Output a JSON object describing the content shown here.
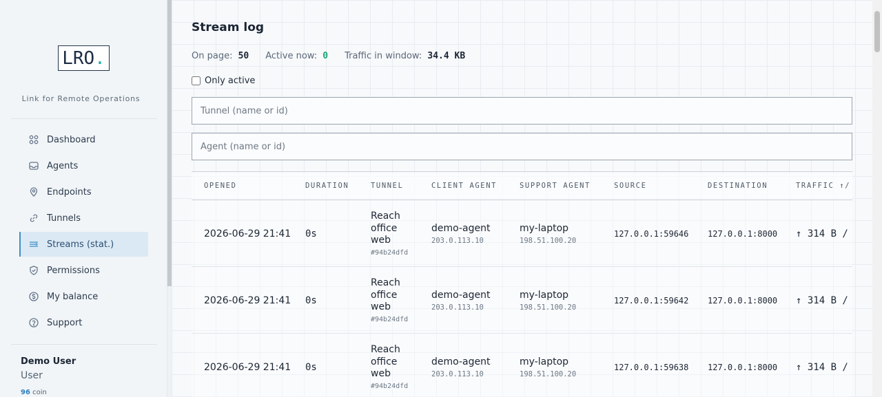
{
  "sidebar": {
    "logo_text": "LRO",
    "logo_dot": ".",
    "tagline": "Link for Remote Operations",
    "nav": [
      {
        "label": "Dashboard",
        "icon": "grid-icon",
        "active": false
      },
      {
        "label": "Agents",
        "icon": "inbox-icon",
        "active": false
      },
      {
        "label": "Endpoints",
        "icon": "map-pin-icon",
        "active": false
      },
      {
        "label": "Tunnels",
        "icon": "link-icon",
        "active": false
      },
      {
        "label": "Streams (stat.)",
        "icon": "streams-icon",
        "active": true
      },
      {
        "label": "Permissions",
        "icon": "shield-check-icon",
        "active": false
      },
      {
        "label": "My balance",
        "icon": "coin-icon",
        "active": false
      },
      {
        "label": "Support",
        "icon": "help-circle-icon",
        "active": false
      }
    ],
    "user": {
      "name": "Demo User",
      "role": "User",
      "balance_amount": "96",
      "balance_unit": "coin"
    }
  },
  "main": {
    "title": "Stream log",
    "stats": {
      "on_page_label": "On page:",
      "on_page_value": "50",
      "active_label": "Active now:",
      "active_value": "0",
      "traffic_label": "Traffic in window:",
      "traffic_value": "34.4 KB"
    },
    "only_active_label": "Only active",
    "tunnel_placeholder": "Tunnel (name or id)",
    "agent_placeholder": "Agent (name or id)",
    "columns": [
      "OPENED",
      "DURATION",
      "TUNNEL",
      "CLIENT AGENT",
      "SUPPORT AGENT",
      "SOURCE",
      "DESTINATION",
      "TRAFFIC ↑/"
    ],
    "rows": [
      {
        "opened": "2026-06-29 21:41",
        "duration": "0s",
        "tunnel_name": "Reach office web",
        "tunnel_id": "#94b24dfd",
        "client_name": "demo-agent",
        "client_ip": "203.0.113.10",
        "support_name": "my-laptop",
        "support_ip": "198.51.100.20",
        "source": "127.0.0.1:59646",
        "destination": "127.0.0.1:8000",
        "traffic": "↑ 314 B /"
      },
      {
        "opened": "2026-06-29 21:41",
        "duration": "0s",
        "tunnel_name": "Reach office web",
        "tunnel_id": "#94b24dfd",
        "client_name": "demo-agent",
        "client_ip": "203.0.113.10",
        "support_name": "my-laptop",
        "support_ip": "198.51.100.20",
        "source": "127.0.0.1:59642",
        "destination": "127.0.0.1:8000",
        "traffic": "↑ 314 B /"
      },
      {
        "opened": "2026-06-29 21:41",
        "duration": "0s",
        "tunnel_name": "Reach office web",
        "tunnel_id": "#94b24dfd",
        "client_name": "demo-agent",
        "client_ip": "203.0.113.10",
        "support_name": "my-laptop",
        "support_ip": "198.51.100.20",
        "source": "127.0.0.1:59638",
        "destination": "127.0.0.1:8000",
        "traffic": "↑ 314 B /"
      }
    ]
  }
}
